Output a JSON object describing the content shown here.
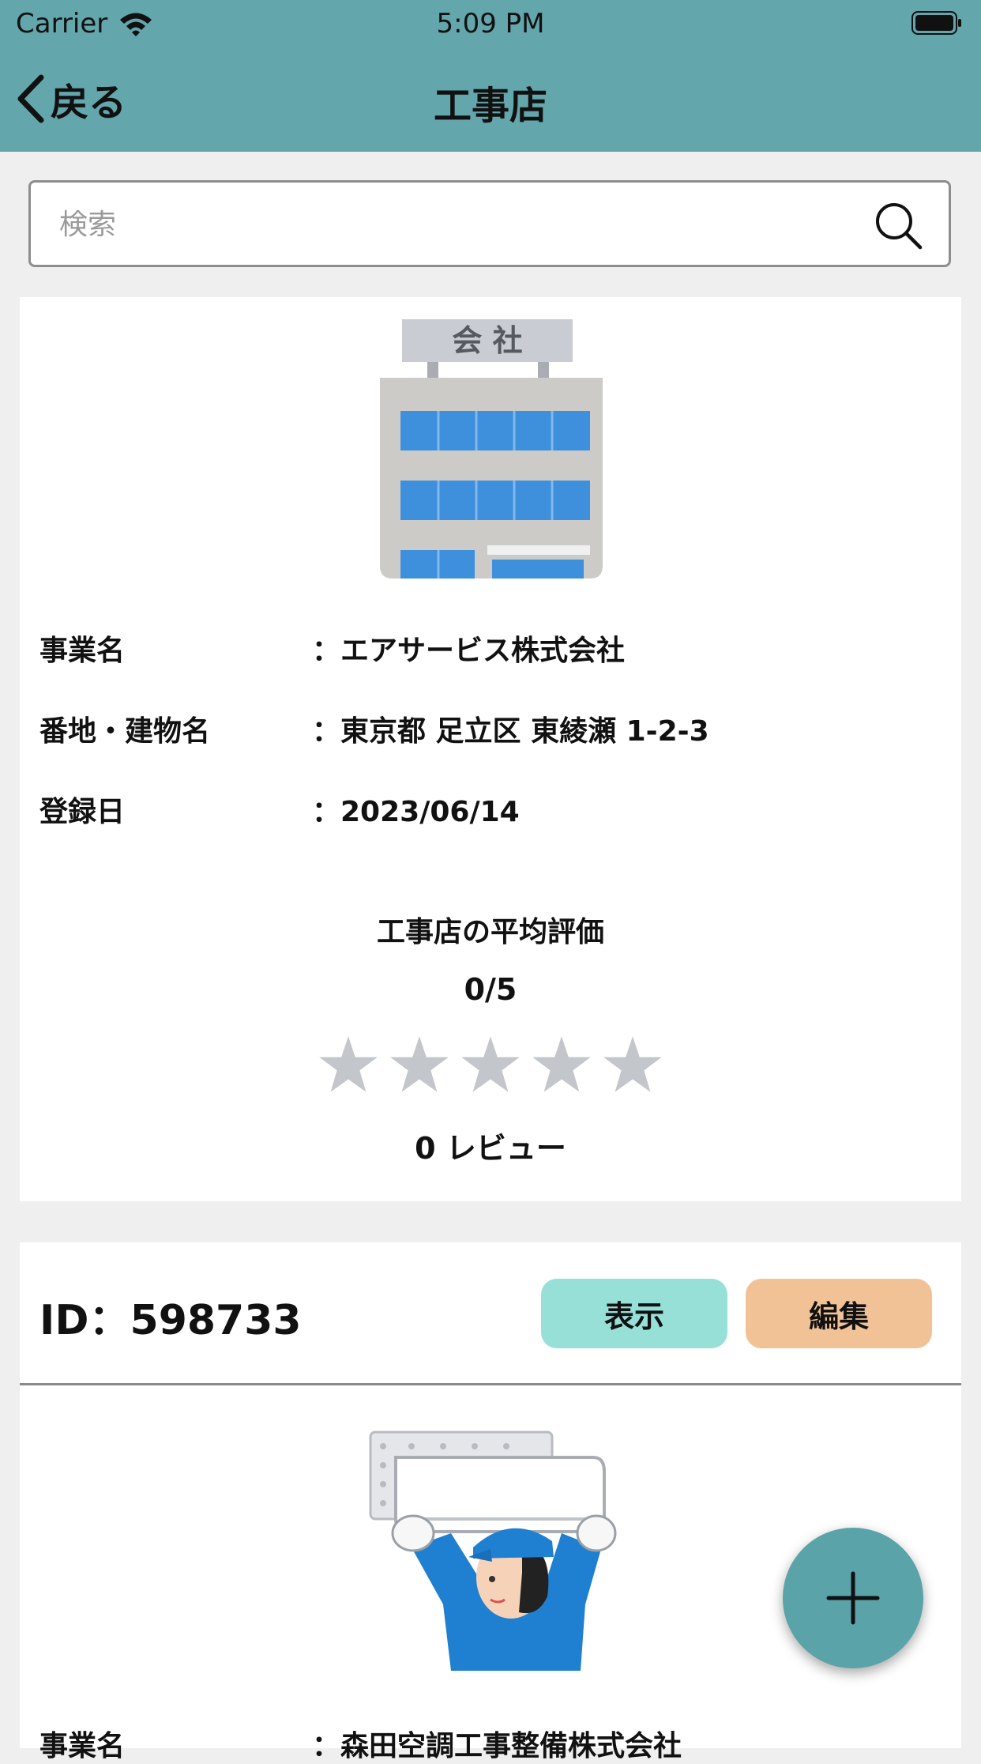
{
  "status_bar": {
    "carrier": "Carrier",
    "time": "5:09 PM"
  },
  "nav": {
    "back_label": "戻る",
    "title": "工事店"
  },
  "search": {
    "placeholder": "検索",
    "value": ""
  },
  "colors": {
    "header": "#63a6ab",
    "view_button": "#96e0d8",
    "edit_button": "#f2c297",
    "fab": "#5aa3a8",
    "star_empty": "#c3c6ca"
  },
  "store_card": {
    "image": "office-building-image",
    "sign_text": "会 社",
    "rows": [
      {
        "label": "事業名",
        "value": "：エアサービス株式会社"
      },
      {
        "label": "番地・建物名",
        "value": "：東京都 足立区 東綾瀬 1-2-3"
      },
      {
        "label": "登録日",
        "value": "：2023/06/14"
      }
    ],
    "rating_title": "工事店の平均評価",
    "rating_score": "0/5",
    "rating_value": 0,
    "rating_max": 5,
    "review_count": "0 レビュー"
  },
  "worker_card": {
    "id_label": "ID：598733",
    "view_label": "表示",
    "edit_label": "編集",
    "image": "ac-technician-image",
    "rows": [
      {
        "label": "事業名",
        "value": "：森田空調工事整備株式会社"
      }
    ]
  },
  "fab": {
    "icon": "plus-icon"
  }
}
